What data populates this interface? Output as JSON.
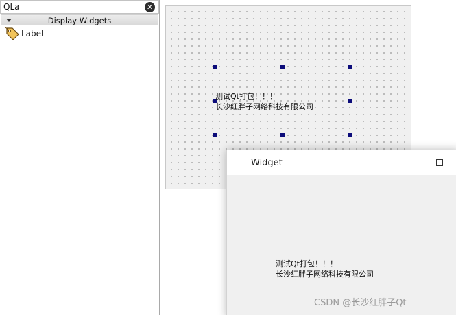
{
  "widget_box": {
    "filter": {
      "value": "QLa",
      "clear_glyph": "✕"
    },
    "category": {
      "label": "Display Widgets",
      "expanded": true
    },
    "items": [
      {
        "label": "Label",
        "icon": "label-tag-icon"
      }
    ]
  },
  "designer": {
    "label_text": {
      "line1": "测试Qt打包！！！",
      "line2": "长沙红胖子网络科技有限公司"
    },
    "selection_color": "#0c0c7a"
  },
  "preview": {
    "title": "Widget",
    "label_text": {
      "line1": "测试Qt打包！！！",
      "line2": "长沙红胖子网络科技有限公司"
    }
  },
  "watermark": "CSDN @长沙红胖子Qt"
}
